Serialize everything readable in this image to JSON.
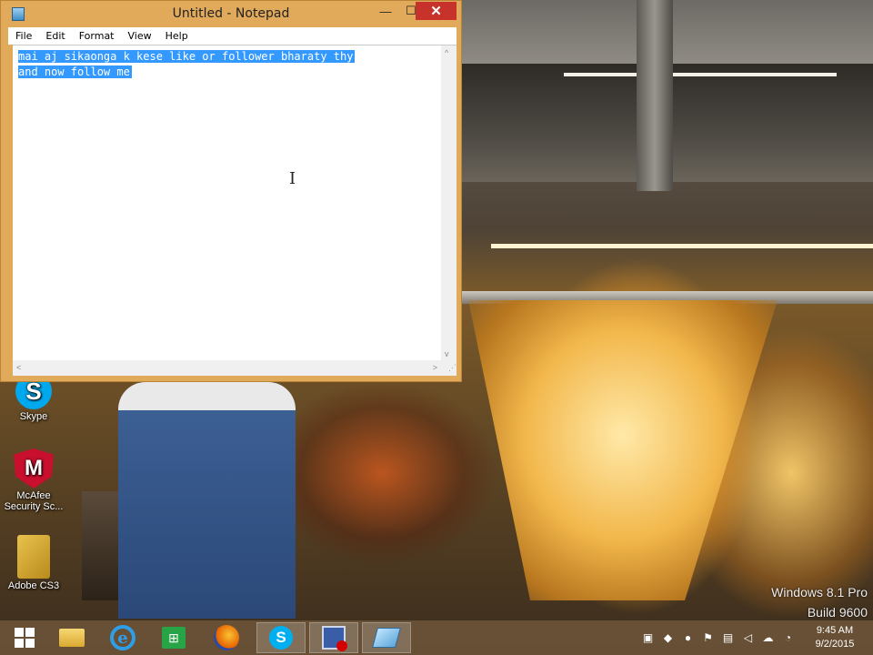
{
  "notepad": {
    "title": "Untitled - Notepad",
    "menu": [
      "File",
      "Edit",
      "Format",
      "View",
      "Help"
    ],
    "content_lines": [
      "mai aj sikaonga k kese like or follower bharaty thy",
      "and now follow me"
    ],
    "controls": {
      "minimize": "—",
      "maximize": "☐",
      "close": "✕"
    }
  },
  "desktop_icons": [
    {
      "label": "Skype",
      "icon": "skype-icon"
    },
    {
      "label": "McAfee Security Sc...",
      "icon": "mcafee-icon"
    },
    {
      "label": "Adobe CS3",
      "icon": "folder-icon"
    }
  ],
  "watermark": {
    "line1": "Windows 8.1 Pro",
    "line2": "Build 9600"
  },
  "taskbar": {
    "apps": [
      "start",
      "file-explorer",
      "internet-explorer",
      "store",
      "firefox",
      "skype",
      "screen-recorder",
      "notepad"
    ],
    "active_app": "notepad"
  },
  "tray_icons": [
    "network-icon",
    "app-icon",
    "norton-icon",
    "flag-icon",
    "power-icon",
    "volume-mute-icon",
    "cloud-icon",
    "notification-icon"
  ],
  "clock": {
    "time": "9:45 AM",
    "date": "9/2/2015"
  },
  "colors": {
    "selection": "#3399ff",
    "close_button": "#c7322a",
    "window_frame": "#e1a95a"
  }
}
